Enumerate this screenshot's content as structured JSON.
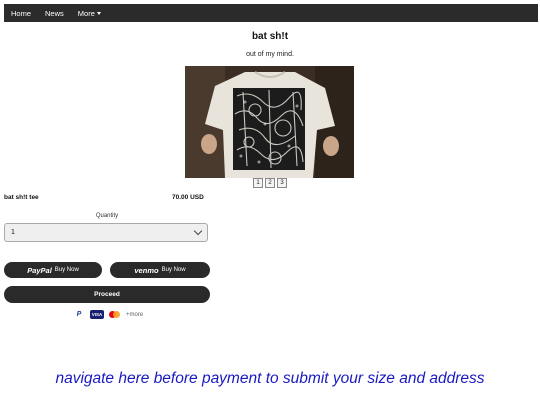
{
  "nav": {
    "items": [
      {
        "label": "Home"
      },
      {
        "label": "News"
      },
      {
        "label": "More"
      }
    ]
  },
  "page": {
    "title": "bat sh!t",
    "subtitle": "out of my mind."
  },
  "gallery": {
    "pages": [
      "1",
      "2",
      "3"
    ]
  },
  "product": {
    "name": "bat sh!t tee",
    "price": "70.00 USD"
  },
  "quantity": {
    "label": "Quantity",
    "value": "1"
  },
  "payment": {
    "paypal_brand": "PayPal",
    "paypal_label": "Buy Now",
    "venmo_brand": "venmo",
    "venmo_label": "Buy Now",
    "proceed_label": "Proceed",
    "more_label": "+more"
  },
  "footer": {
    "link_text": "navigate here before payment to submit your size and address"
  }
}
